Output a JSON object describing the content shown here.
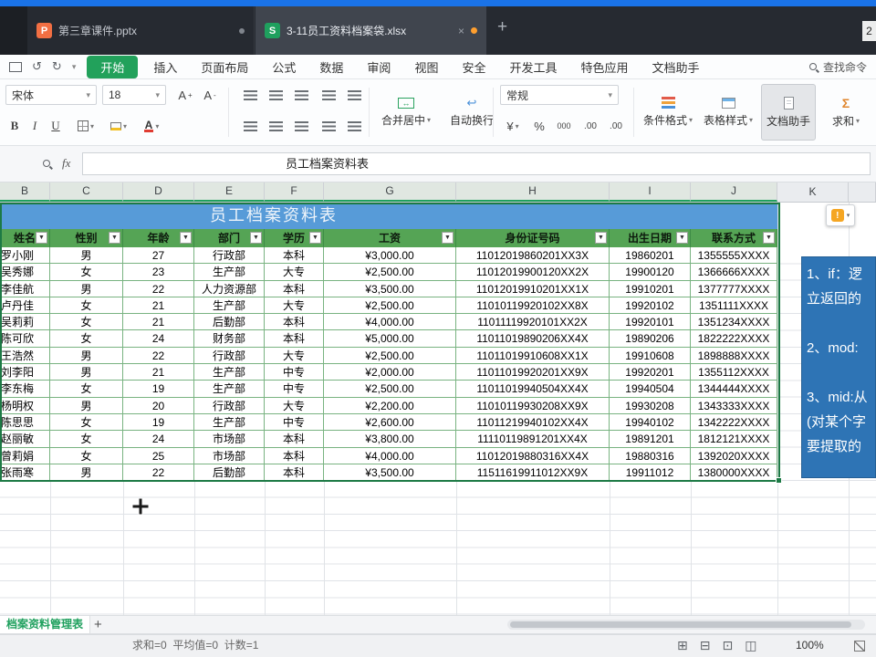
{
  "titlebar": {
    "tabs": [
      {
        "icon_letter": "P",
        "label": "第三章课件.pptx"
      },
      {
        "icon_letter": "S",
        "label": "3-11员工资料档案袋.xlsx"
      }
    ],
    "new_tab_label": "+",
    "window_badge": "2"
  },
  "menubar": {
    "home_tab": "开始",
    "items": [
      "插入",
      "页面布局",
      "公式",
      "数据",
      "审阅",
      "视图",
      "安全",
      "开发工具",
      "特色应用",
      "文档助手"
    ],
    "search_label": "查找命令"
  },
  "toolbar": {
    "font_name": "宋体",
    "font_size": "18",
    "bold": "B",
    "italic": "I",
    "underline": "U",
    "merge_center": "合并居中",
    "wrap_text": "自动换行",
    "number_format": "常规",
    "number_icons": {
      "currency": "¥",
      "percent": "%",
      "thousand": "000",
      "dec_inc": ".00",
      "dec_dec": ".00"
    },
    "cond_format": "条件格式",
    "table_style": "表格样式",
    "doc_helper": "文档助手",
    "sum": "求和"
  },
  "formula_bar": {
    "fx_label": "fx",
    "value": "员工档案资料表"
  },
  "sheet": {
    "column_letters": [
      "B",
      "C",
      "D",
      "E",
      "F",
      "G",
      "H",
      "I",
      "J",
      "K"
    ],
    "table_title": "员工档案资料表",
    "headers": [
      "姓名",
      "性别",
      "年龄",
      "部门",
      "学历",
      "工资",
      "身份证号码",
      "出生日期",
      "联系方式"
    ],
    "rows": [
      [
        "罗小刚",
        "男",
        "27",
        "行政部",
        "本科",
        "¥3,000.00",
        "11012019860201XX3X",
        "19860201",
        "1355555XXXX"
      ],
      [
        "吴秀娜",
        "女",
        "23",
        "生产部",
        "大专",
        "¥2,500.00",
        "11012019900120XX2X",
        "19900120",
        "1366666XXXX"
      ],
      [
        "李佳航",
        "男",
        "22",
        "人力资源部",
        "本科",
        "¥3,500.00",
        "11012019910201XX1X",
        "19910201",
        "1377777XXXX"
      ],
      [
        "卢丹佳",
        "女",
        "21",
        "生产部",
        "大专",
        "¥2,500.00",
        "11010119920102XX8X",
        "19920102",
        "1351111XXXX"
      ],
      [
        "吴莉莉",
        "女",
        "21",
        "后勤部",
        "本科",
        "¥4,000.00",
        "11011119920101XX2X",
        "19920101",
        "1351234XXXX"
      ],
      [
        "陈可欣",
        "女",
        "24",
        "财务部",
        "本科",
        "¥5,000.00",
        "11011019890206XX4X",
        "19890206",
        "1822222XXXX"
      ],
      [
        "王浩然",
        "男",
        "22",
        "行政部",
        "大专",
        "¥2,500.00",
        "11011019910608XX1X",
        "19910608",
        "1898888XXXX"
      ],
      [
        "刘李阳",
        "男",
        "21",
        "生产部",
        "中专",
        "¥2,000.00",
        "11011019920201XX9X",
        "19920201",
        "1355112XXXX"
      ],
      [
        "李东梅",
        "女",
        "19",
        "生产部",
        "中专",
        "¥2,500.00",
        "11011019940504XX4X",
        "19940504",
        "1344444XXXX"
      ],
      [
        "杨明权",
        "男",
        "20",
        "行政部",
        "大专",
        "¥2,200.00",
        "11010119930208XX9X",
        "19930208",
        "1343333XXXX"
      ],
      [
        "陈思思",
        "女",
        "19",
        "生产部",
        "中专",
        "¥2,600.00",
        "11011219940102XX4X",
        "19940102",
        "1342222XXXX"
      ],
      [
        "赵丽敏",
        "女",
        "24",
        "市场部",
        "本科",
        "¥3,800.00",
        "11110119891201XX4X",
        "19891201",
        "1812121XXXX"
      ],
      [
        "曾莉娟",
        "女",
        "25",
        "市场部",
        "本科",
        "¥4,000.00",
        "11012019880316XX4X",
        "19880316",
        "1392020XXXX"
      ],
      [
        "张雨寒",
        "男",
        "22",
        "后勤部",
        "本科",
        "¥3,500.00",
        "11511619911012XX9X",
        "19911012",
        "1380000XXXX"
      ]
    ]
  },
  "side_panel": {
    "lines": [
      "1、if：逻",
      "立返回的",
      "",
      "2、mod:",
      "",
      "3、mid:从",
      "(对某个字",
      "要提取的"
    ]
  },
  "sheet_tabs": {
    "active_sheet": "档案资料管理表",
    "add_label": "+"
  },
  "status_bar": {
    "summary": "求和=0  平均值=0  计数=1",
    "zoom": "100%"
  },
  "colors": {
    "accent_green": "#21a366",
    "title_blue": "#579bd8",
    "header_green": "#55a455",
    "panel_blue": "#2e74b5",
    "tab_ppt_orange": "#f26f43",
    "unsaved_orange": "#ff9f2e"
  }
}
